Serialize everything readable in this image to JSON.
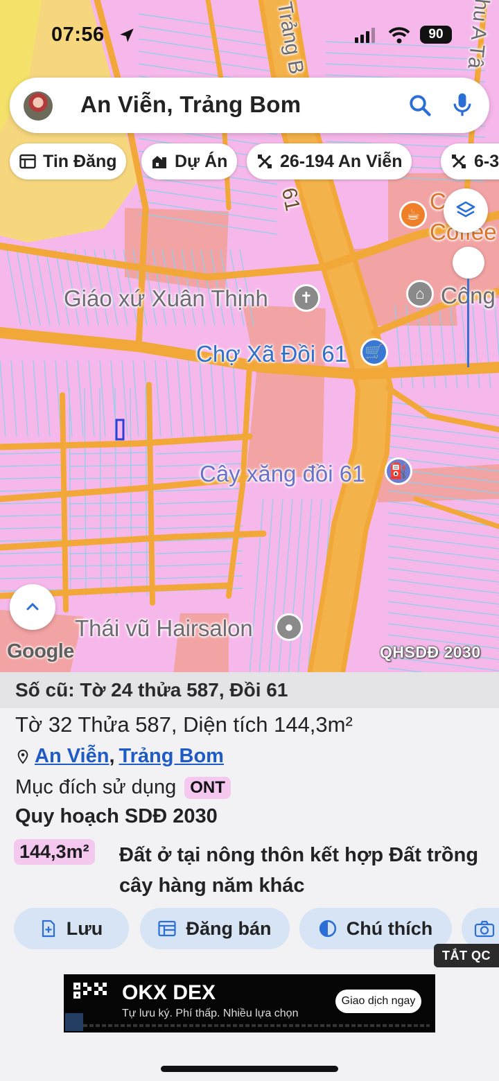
{
  "status_bar": {
    "time": "07:56",
    "battery": "90"
  },
  "search": {
    "query": "An Viễn, Trảng Bom",
    "icons": [
      "avatar",
      "search-icon",
      "mic-icon"
    ]
  },
  "chips": [
    {
      "label": "Tin Đăng",
      "icon": "listing-icon"
    },
    {
      "label": "Dự Án",
      "icon": "building-icon"
    },
    {
      "label": "26-194 An Viễn",
      "icon": "parcel-icon"
    },
    {
      "label": "6-3",
      "icon": "parcel-icon"
    }
  ],
  "map": {
    "road_labels": {
      "main_road": "61",
      "street_top": "Trảng B",
      "street_right": "hu A Tâ"
    },
    "pois": {
      "church": "Giáo xứ Xuân Thịnh",
      "market": "Chợ Xã Đồi 61",
      "gas": "Cây xăng đồi 61",
      "salon": "Thái vũ Hairsalon",
      "cafe_top": "C L",
      "cafe_bottom": "Coffee",
      "office": "Công"
    },
    "google": "Google",
    "plan_tag": "QHSDĐ 2030",
    "colors": {
      "residential": "#f6b8ea",
      "commercial": "#f2a3a3",
      "road": "#f2a838",
      "agricultural": "#f7d77e",
      "parcel_lines": "#8fd0e8"
    }
  },
  "sheet": {
    "header": "Số cũ: Tờ 24 thửa 587, Đồi 61",
    "line1": "Tờ 32 Thửa 587, Diện tích 144,3m²",
    "location": {
      "commune": "An Viễn",
      "separator": ",",
      "district": "Trảng Bom"
    },
    "purpose_label": "Mục đích sử dụng",
    "purpose_code": "ONT",
    "plan_title": "Quy hoạch SDĐ 2030",
    "area": "144,3m²",
    "area_desc": "Đất ở tại nông thôn kết hợp Đất trồng cây hàng năm khác",
    "actions": [
      {
        "label": "Lưu",
        "icon": "save-icon"
      },
      {
        "label": "Đăng bán",
        "icon": "post-icon"
      },
      {
        "label": "Chú thích",
        "icon": "legend-icon"
      },
      {
        "label": "",
        "icon": "camera-icon"
      }
    ],
    "ad_off": "TẮT QC"
  },
  "ad": {
    "brand": "OKX DEX",
    "subtitle": "Tự lưu ký. Phí thấp. Nhiều lựa chọn",
    "cta": "Giao dịch ngay"
  }
}
